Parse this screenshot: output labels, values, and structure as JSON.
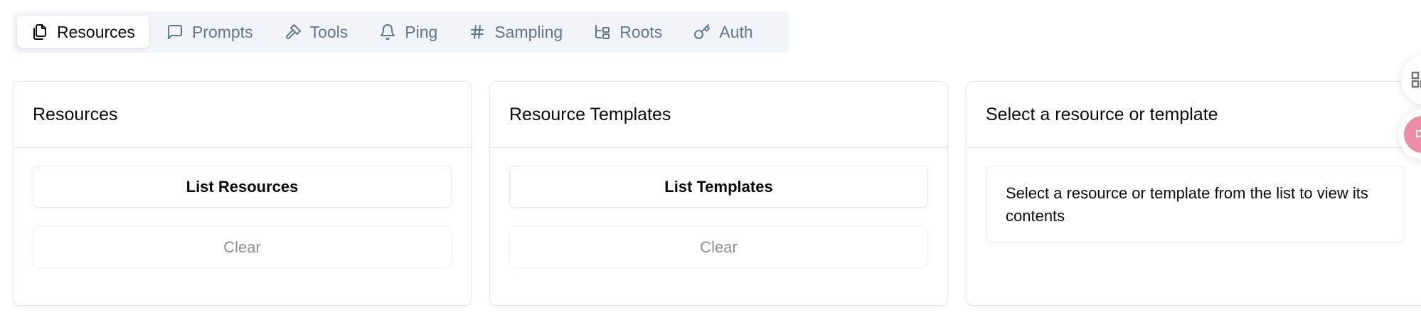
{
  "tabs": [
    {
      "label": "Resources",
      "icon": "files-icon",
      "active": true
    },
    {
      "label": "Prompts",
      "icon": "message-square-icon"
    },
    {
      "label": "Tools",
      "icon": "hammer-icon"
    },
    {
      "label": "Ping",
      "icon": "bell-icon"
    },
    {
      "label": "Sampling",
      "icon": "hash-icon"
    },
    {
      "label": "Roots",
      "icon": "folder-tree-icon"
    },
    {
      "label": "Auth",
      "icon": "key-icon"
    }
  ],
  "resources": {
    "title": "Resources",
    "list_label": "List Resources",
    "clear_label": "Clear"
  },
  "templates": {
    "title": "Resource Templates",
    "list_label": "List Templates",
    "clear_label": "Clear"
  },
  "detail": {
    "title": "Select a resource or template",
    "message": "Select a resource or template from the list to view its contents"
  },
  "floating": {
    "ime_label": "中"
  },
  "colors": {
    "tab_bg": "#f1f5f9",
    "muted": "#64748b",
    "ime": "#ec8fa6"
  }
}
